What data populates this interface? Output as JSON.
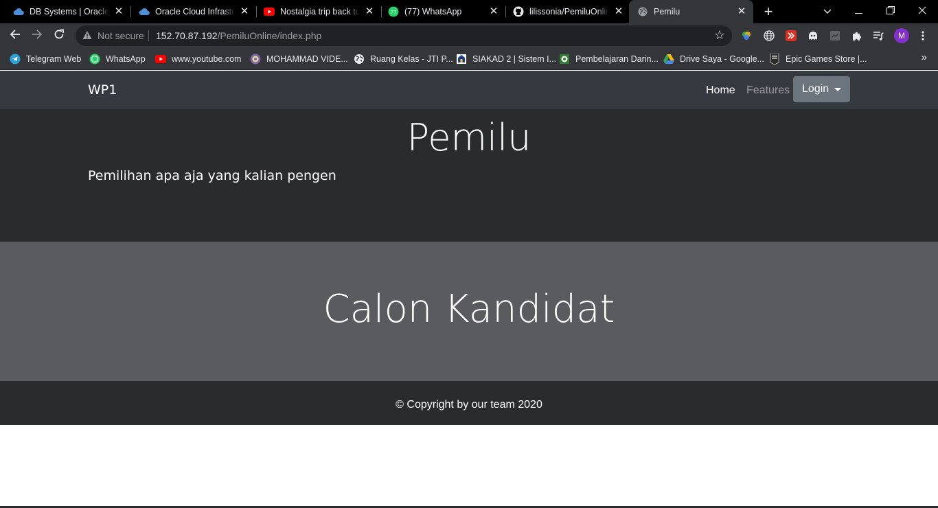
{
  "browser": {
    "tabs": [
      {
        "title": "DB Systems | Oracle Cl",
        "icon": "oracle-cloud-icon"
      },
      {
        "title": "Oracle Cloud Infrastru",
        "icon": "oracle-cloud-icon"
      },
      {
        "title": "Nostalgia trip back to",
        "icon": "youtube-icon"
      },
      {
        "title": "(77) WhatsApp",
        "icon": "whatsapp-icon"
      },
      {
        "title": "lilissonia/PemiluOnline",
        "icon": "github-icon"
      },
      {
        "title": "Pemilu",
        "icon": "globe-icon"
      }
    ],
    "address": {
      "security_label": "Not secure",
      "url_host": "152.70.87.192",
      "url_path": "/PemiluOnline/index.php"
    },
    "profile_initial": "M",
    "bookmarks": [
      {
        "label": "Telegram Web",
        "icon": "telegram-icon"
      },
      {
        "label": "WhatsApp",
        "icon": "whatsapp-icon"
      },
      {
        "label": "www.youtube.com",
        "icon": "youtube-icon"
      },
      {
        "label": "MOHAMMAD VIDE...",
        "icon": "seal-icon"
      },
      {
        "label": "Ruang Kelas - JTI P...",
        "icon": "globe-icon"
      },
      {
        "label": "SIAKAD 2 | Sistem I...",
        "icon": "siakad-icon"
      },
      {
        "label": "Pembelajaran Darin...",
        "icon": "campus-icon"
      },
      {
        "label": "Drive Saya - Google...",
        "icon": "google-drive-icon"
      },
      {
        "label": "Epic Games Store |...",
        "icon": "epic-games-icon"
      }
    ],
    "colors": {
      "tabstrip": "#000000",
      "toolbar": "#35363a",
      "omnibox": "#202124"
    }
  },
  "page": {
    "navbar": {
      "brand": "WP1",
      "home": "Home",
      "features": "Features",
      "login": "Login"
    },
    "jumbotron": {
      "title": "Pemilu",
      "lead": "Pemilihan apa aja yang kalian pengen"
    },
    "section": {
      "title": "Calon Kandidat"
    },
    "footer": {
      "text": "© Copyright by our team 2020"
    },
    "colors": {
      "navbar": "#343a40",
      "jumbotron": "#2a2b2d",
      "section": "#5a5b5e",
      "button": "#6c757d"
    }
  }
}
